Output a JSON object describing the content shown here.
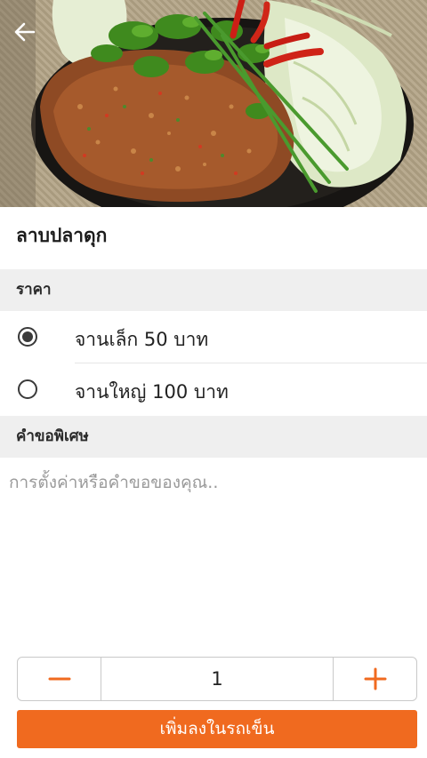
{
  "app": {
    "accent_color": "#f06a1f"
  },
  "header": {
    "back_icon": "arrow-left-icon"
  },
  "dish": {
    "name": "ลาบปลาดุก"
  },
  "price_section": {
    "title": "ราคา",
    "options": [
      {
        "label": "จานเล็ก 50 บาท",
        "selected": true
      },
      {
        "label": "จานใหญ่ 100 บาท",
        "selected": false
      }
    ]
  },
  "request_section": {
    "title": "คำขอพิเศษ",
    "placeholder": "การตั้งค่าหรือคำขอของคุณ..",
    "value": ""
  },
  "quantity": {
    "value": "1",
    "minus_icon": "minus-icon",
    "plus_icon": "plus-icon"
  },
  "actions": {
    "add_to_cart_label": "เพิ่มลงในรถเข็น"
  }
}
